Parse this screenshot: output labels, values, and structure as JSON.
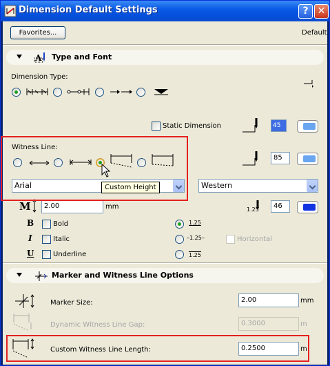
{
  "window": {
    "title": "Dimension Default Settings",
    "help_glyph": "?",
    "close_glyph": "✕"
  },
  "top": {
    "favorites_label": "Favorites...",
    "default_label": "Default"
  },
  "type_font": {
    "title": "Type and Font",
    "dimension_type_label": "Dimension Type:",
    "static_dimension_label": "Static Dimension",
    "pen_value_1": "45",
    "witness_line_label": "Witness Line:",
    "pen_value_2": "85",
    "tooltip": "Custom Height",
    "font_value": "Arial",
    "script_value": "Western",
    "size_value": "2.00",
    "size_unit": "mm",
    "pen_label": "1.25",
    "pen_value_3": "46",
    "bold_label": "Bold",
    "italic_label": "Italic",
    "underline_label": "Underline",
    "pos_top": "1.25",
    "pos_mid": "–1.25–",
    "pos_bottom": "1.25",
    "horizontal_label": "Horizontal",
    "bold_glyph": "B",
    "italic_glyph": "I",
    "underline_glyph": "U"
  },
  "marker": {
    "title": "Marker and Witness Line Options",
    "marker_size_label": "Marker Size:",
    "marker_size_value": "2.00",
    "marker_size_unit": "mm",
    "gap_label": "Dynamic Witness Line Gap:",
    "gap_value": "0.3000",
    "gap_unit": "m",
    "custom_label": "Custom Witness Line Length:",
    "custom_value": "0.2500",
    "custom_unit": "m"
  },
  "colors": {
    "title_bar": "#0a5be6",
    "highlight": "#e42020",
    "radio_selected": "#21a121"
  }
}
